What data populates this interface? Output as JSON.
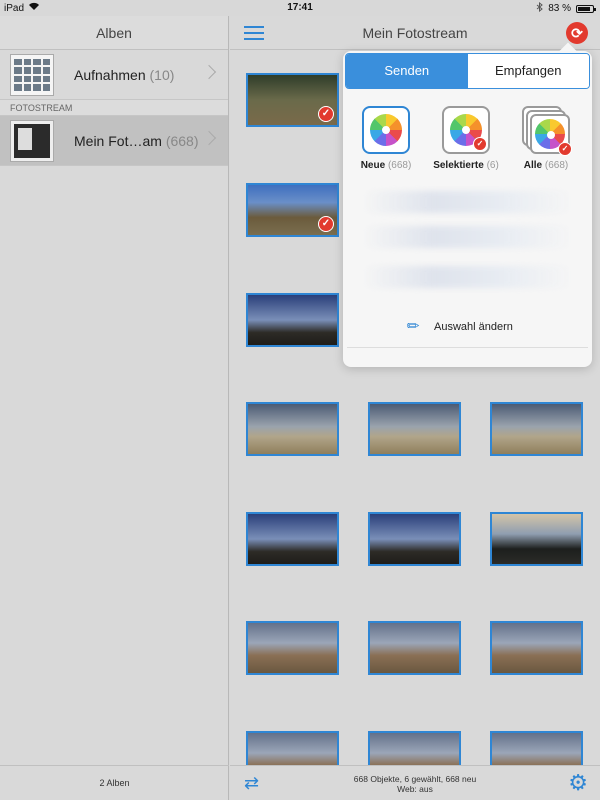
{
  "status_bar": {
    "device": "iPad",
    "time": "17:41",
    "battery": "83 %",
    "battery_level": 0.83
  },
  "sidebar": {
    "title": "Alben",
    "albums": [
      {
        "name": "Aufnahmen",
        "count": "(10)"
      }
    ],
    "section_label": "FOTOSTREAM",
    "stream_album": {
      "name": "Mein Fot…am",
      "count": "(668)"
    },
    "footer": "2 Alben"
  },
  "main": {
    "title": "Mein Fotostream",
    "footer_line1": "668 Objekte, 6 gewählt, 668 neu",
    "footer_line2": "Web: aus"
  },
  "popover": {
    "tab_send": "Senden",
    "tab_receive": "Empfangen",
    "options": [
      {
        "label": "Neue",
        "count": "(668)"
      },
      {
        "label": "Selektierte",
        "count": "(6)"
      },
      {
        "label": "Alle",
        "count": "(668)"
      }
    ],
    "change_selection": "Auswahl ändern"
  },
  "colors": {
    "accent": "#2f86d4",
    "selection_badge": "#e23a2e"
  },
  "icons": [
    "wifi-icon",
    "bluetooth-icon",
    "battery-icon",
    "menu-icon",
    "sync-icon",
    "checkmark-icon",
    "photos-icon",
    "pencil-icon",
    "transfer-icon",
    "gear-icon"
  ]
}
